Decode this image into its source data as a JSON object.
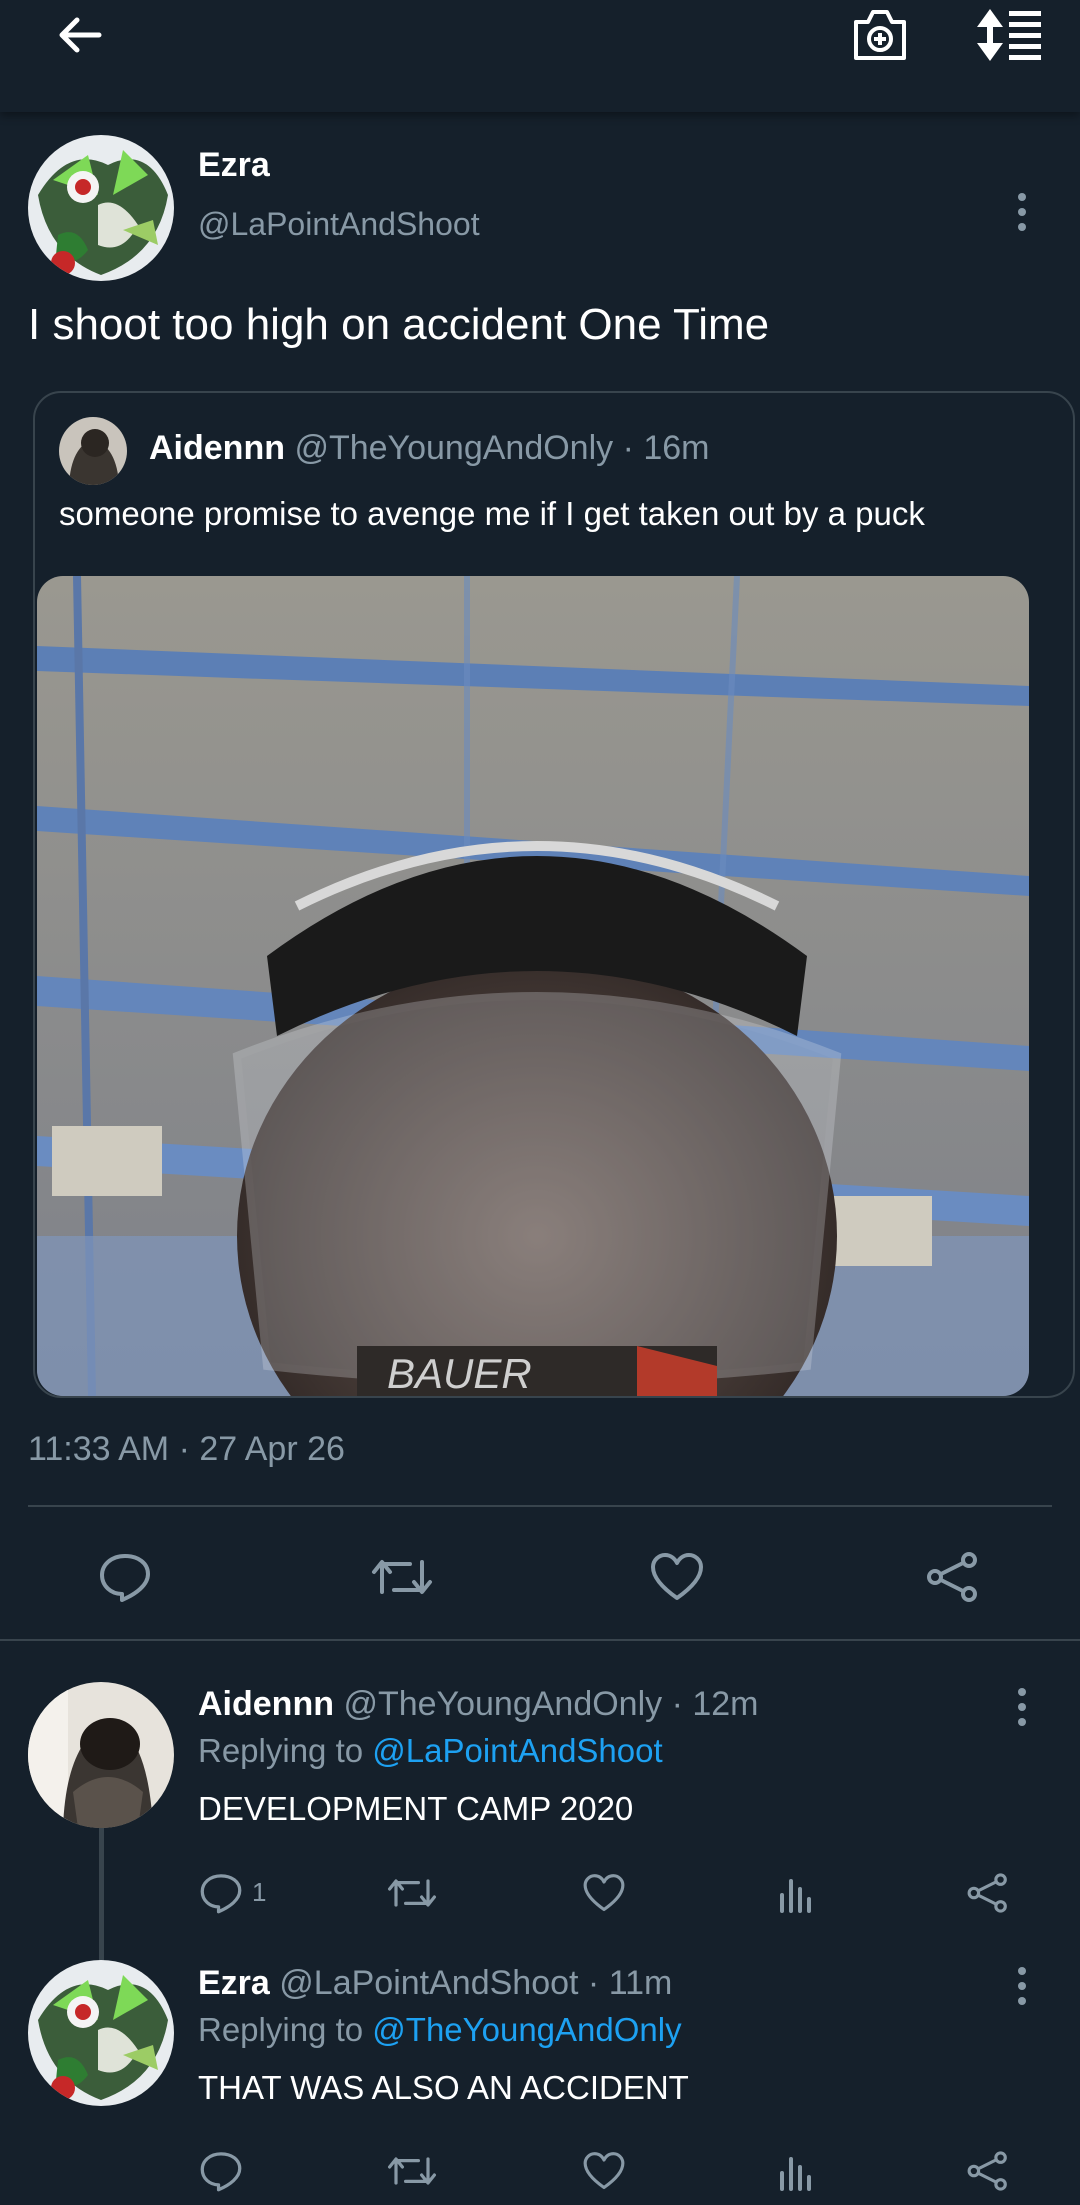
{
  "top_bar": {
    "back_icon": "arrow-left-icon",
    "compose_icon": "camera-plus-icon",
    "sort_icon": "sort-icon"
  },
  "tweet": {
    "author_name": "Ezra",
    "author_handle": "@LaPointAndShoot",
    "text": "I shoot too high on accident One Time",
    "timestamp": "11:33 AM · 27 Apr 26",
    "quote": {
      "author_name": "Aidennn",
      "author_handle": "@TheYoungAndOnly",
      "time": "· 16m",
      "text": "someone promise to avenge me if I get taken out by a puck",
      "image_text": "BAUER"
    },
    "actions": [
      "reply-icon",
      "retweet-icon",
      "like-icon",
      "share-icon"
    ]
  },
  "replies": [
    {
      "author_name": "Aidennn",
      "author_handle": "@TheYoungAndOnly",
      "time": "· 12m",
      "replying_label": "Replying to",
      "replying_to": "@LaPointAndShoot",
      "text": "DEVELOPMENT CAMP 2020",
      "reply_count": "1"
    },
    {
      "author_name": "Ezra",
      "author_handle": "@LaPointAndShoot",
      "time": "· 11m",
      "replying_label": "Replying to",
      "replying_to": "@TheYoungAndOnly",
      "text": "THAT WAS ALSO AN ACCIDENT",
      "reply_count": ""
    }
  ],
  "colors": {
    "background": "#15202b",
    "muted": "#8899a6",
    "link": "#1da1f2",
    "divider": "#38444d"
  }
}
